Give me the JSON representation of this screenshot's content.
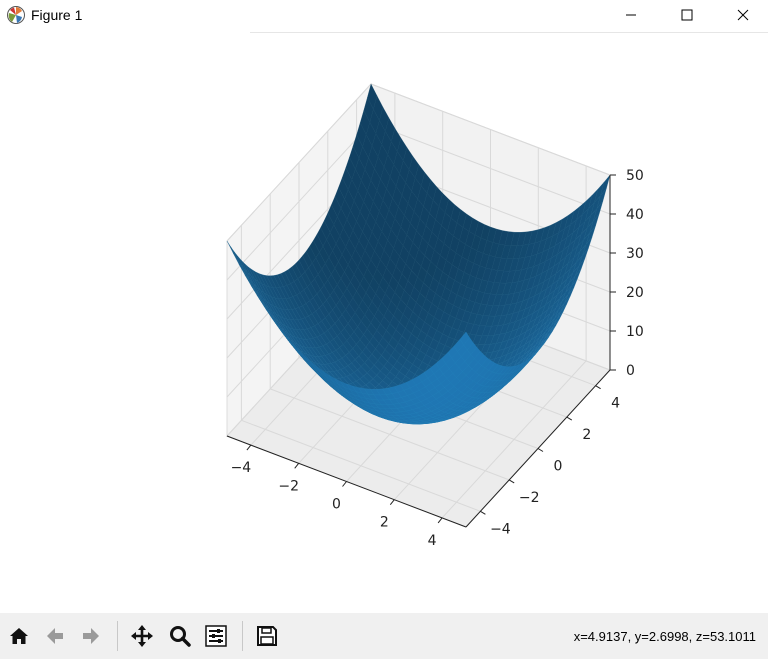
{
  "window": {
    "title": "Figure 1"
  },
  "toolbar": {
    "buttons": [
      "home-icon",
      "back-icon",
      "forward-icon",
      "pan-icon",
      "zoom-icon",
      "configure-subplots-icon",
      "save-icon"
    ],
    "coords_text": "x=4.9137, y=2.6998, z=53.1011"
  },
  "chart_data": {
    "type": "surface",
    "function": "z = x^2 + y^2",
    "x_range": [
      -5,
      5
    ],
    "y_range": [
      -5,
      5
    ],
    "z_range": [
      0,
      50
    ],
    "x_ticks": [
      "−4",
      "−2",
      "0",
      "2",
      "4"
    ],
    "y_ticks": [
      "−4",
      "−2",
      "0",
      "2",
      "4"
    ],
    "z_ticks": [
      "0",
      "10",
      "20",
      "30",
      "40",
      "50"
    ],
    "colors": {
      "surface": "#1f77b4",
      "pane": "#f2f2f2",
      "grid": "#d9d9d9"
    },
    "grid": true
  }
}
